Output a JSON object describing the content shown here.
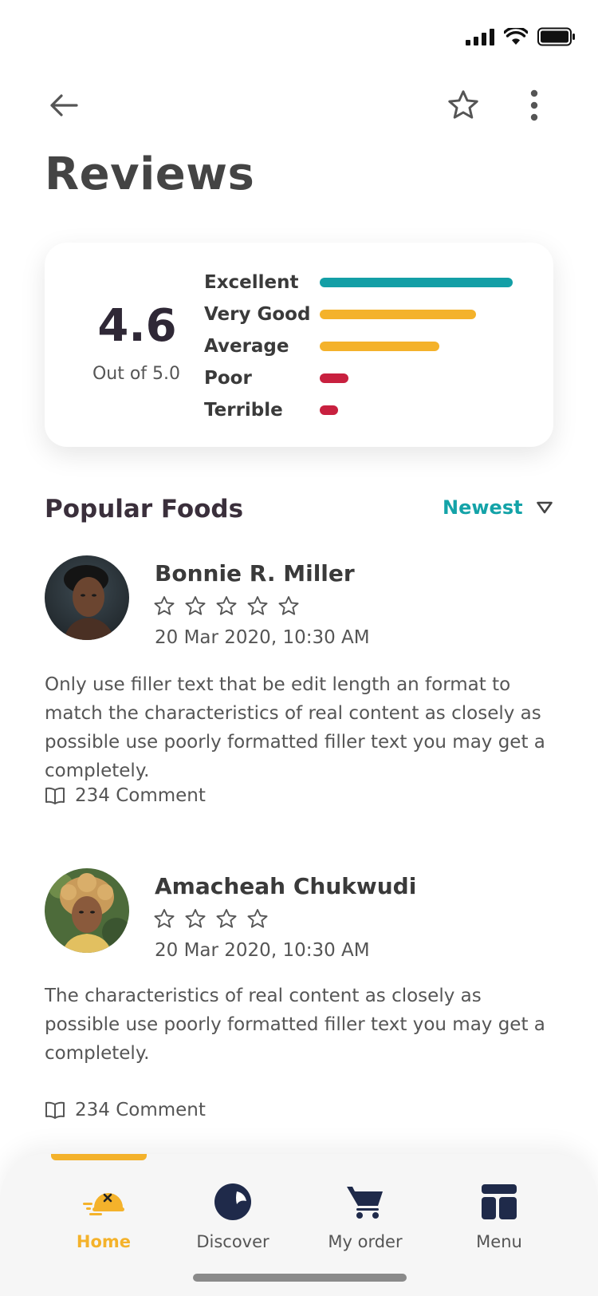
{
  "header": {
    "title": "Reviews",
    "back_icon": "arrow-left-icon",
    "favorite_icon": "star-outline-icon",
    "more_icon": "more-vertical-icon"
  },
  "rating_summary": {
    "score": "4.6",
    "out_of": "Out of 5.0",
    "breakdown": [
      {
        "label": "Excellent",
        "level": 0.95,
        "color": "#139fa6"
      },
      {
        "label": "Very Good",
        "level": 0.77,
        "color": "#f4b22b"
      },
      {
        "label": "Average",
        "level": 0.59,
        "color": "#f4b22b"
      },
      {
        "label": "Poor",
        "level": 0.14,
        "color": "#c8203f"
      },
      {
        "label": "Terrible",
        "level": 0.09,
        "color": "#c8203f"
      }
    ]
  },
  "section": {
    "title": "Popular Foods",
    "sort_label": "Newest",
    "sort_icon": "triangle-down-icon"
  },
  "reviews": [
    {
      "name": "Bonnie R. Miller",
      "stars_filled": 0,
      "stars_shown": 5,
      "date": "20 Mar 2020, 10:30 AM",
      "text": "Only use filler text that be edit length an format to match the characteristics of real content as closely as possible use poorly formatted filler text you may get a completely.",
      "comments": "234 Comment"
    },
    {
      "name": "Amacheah Chukwudi",
      "stars_filled": 0,
      "stars_shown": 4,
      "date": "20 Mar 2020, 10:30 AM",
      "text": "The characteristics of real content as closely as possible use poorly formatted filler text you may get a completely.",
      "comments": "234 Comment"
    }
  ],
  "bottom_nav": {
    "items": [
      {
        "label": "Home",
        "icon": "home-delivery-icon",
        "active": true
      },
      {
        "label": "Discover",
        "icon": "compass-icon",
        "active": false
      },
      {
        "label": "My order",
        "icon": "cart-icon",
        "active": false
      },
      {
        "label": "Menu",
        "icon": "menu-grid-icon",
        "active": false
      }
    ],
    "accent_color": "#f4b22b"
  }
}
